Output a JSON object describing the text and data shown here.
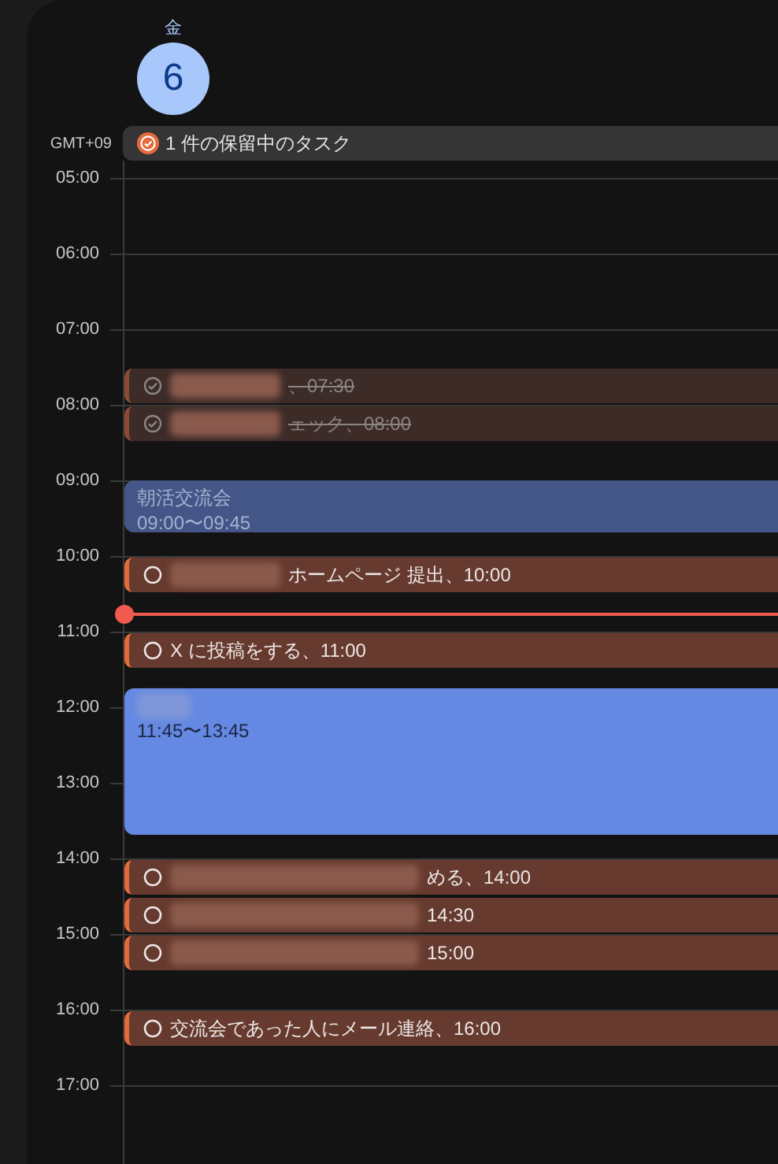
{
  "day": {
    "weekday": "金",
    "date": "6"
  },
  "all_day": {
    "timezone": "GMT+09",
    "pending_tasks": "1 件の保留中のタスク"
  },
  "hours": [
    {
      "label": "05:00"
    },
    {
      "label": "06:00"
    },
    {
      "label": "07:00",
      "tasks": [
        {
          "title": "、07:30",
          "redacted": true,
          "wide": false,
          "completed": true,
          "half_past": true
        }
      ]
    },
    {
      "label": "08:00",
      "tasks": [
        {
          "title": "ェック、08:00",
          "redacted": true,
          "wide": false,
          "completed": true,
          "half_past": false
        }
      ]
    },
    {
      "label": "09:00"
    },
    {
      "label": "10:00",
      "now_line": true,
      "tasks": [
        {
          "title": "ホームページ 提出、10:00",
          "redacted": true,
          "wide": false,
          "completed": false,
          "half_past": false
        }
      ]
    },
    {
      "label": "11:00",
      "tasks": [
        {
          "title": "X に投稿をする、11:00",
          "redacted": false,
          "completed": false,
          "half_past": false
        }
      ]
    },
    {
      "label": "12:00"
    },
    {
      "label": "13:00"
    },
    {
      "label": "14:00",
      "tasks": [
        {
          "title": "める、14:00",
          "redacted": true,
          "wide": true,
          "completed": false,
          "half_past": false
        },
        {
          "title": "14:30",
          "redacted": true,
          "wide": true,
          "completed": false,
          "half_past": true
        }
      ]
    },
    {
      "label": "15:00",
      "tasks": [
        {
          "title": "15:00",
          "redacted": true,
          "wide": true,
          "completed": false,
          "half_past": false
        }
      ]
    },
    {
      "label": "16:00",
      "tasks": [
        {
          "title": "交流会であった人にメール連絡、16:00",
          "redacted": false,
          "completed": false,
          "half_past": false
        }
      ]
    },
    {
      "label": "17:00"
    }
  ],
  "events": [
    {
      "title": "朝活交流会",
      "time": "09:00〜09:45",
      "past": true
    },
    {
      "time": "11:45〜13:45",
      "redacted": true,
      "past": false
    }
  ]
}
